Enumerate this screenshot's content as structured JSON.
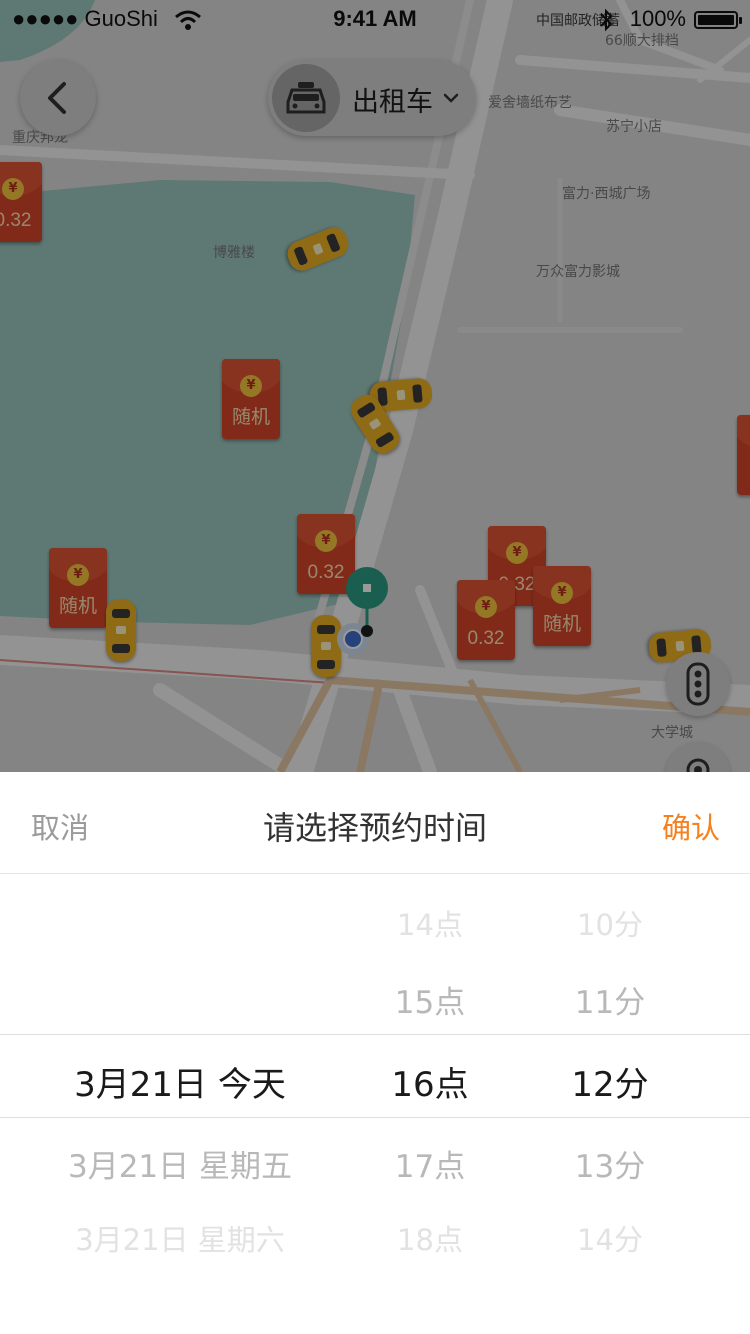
{
  "status_bar": {
    "carrier": "●●●●● GuoShi",
    "time": "9:41 AM",
    "operator_text": "中国邮政储蓄",
    "battery_percent": "100%",
    "battery_level": 1.0
  },
  "header": {
    "car_type_label": "出租车",
    "car_type_icon": "taxi-icon",
    "back_icon": "chevron-left-icon"
  },
  "map": {
    "pois": [
      "66顺大排档",
      "爱舍墙纸布艺",
      "苏宁小店",
      "富力·西城广场",
      "万众富力影城",
      "博雅楼",
      "重庆邦龙",
      "大学城"
    ],
    "envelopes": [
      "0.32",
      "随机",
      "0.32",
      "随机",
      "0.32",
      "随机",
      "0.32"
    ],
    "envelope_symbol": "¥"
  },
  "picker": {
    "cancel_label": "取消",
    "title": "请选择预约时间",
    "confirm_label": "确认",
    "date_column": [
      "",
      "",
      "3月21日  今天",
      "3月21日  星期五",
      "3月21日  星期六"
    ],
    "hour_column": [
      "14点",
      "15点",
      "16点",
      "17点",
      "18点"
    ],
    "minute_column": [
      "10分",
      "11分",
      "12分",
      "13分",
      "14分"
    ],
    "selected_index": 2
  },
  "colors": {
    "confirm": "#f5811f",
    "envelope": "#d8472a",
    "taxi": "#f0b323",
    "pin": "#2a9d83"
  }
}
